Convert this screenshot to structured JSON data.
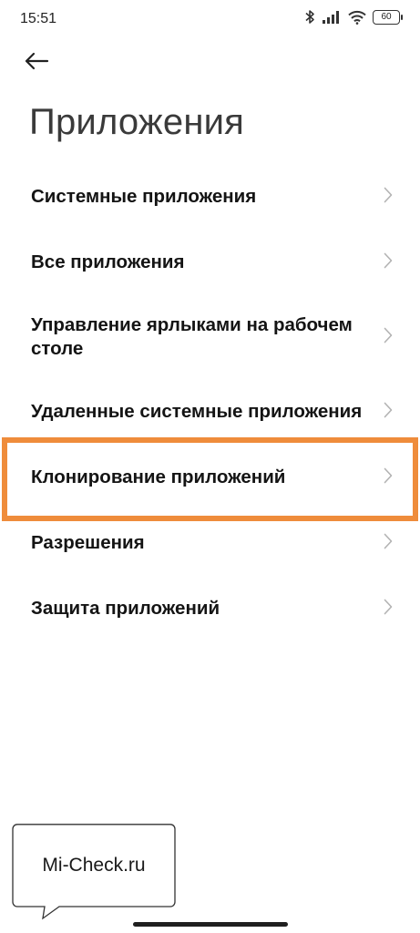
{
  "status_bar": {
    "time": "15:51",
    "battery_level": "60",
    "icons": [
      "bluetooth-icon",
      "signal-icon",
      "wifi-icon",
      "battery-icon"
    ]
  },
  "header": {
    "back_icon": "arrow-left-icon",
    "title": "Приложения"
  },
  "menu": {
    "items": [
      {
        "label": "Системные приложения"
      },
      {
        "label": "Все приложения"
      },
      {
        "label": "Управление ярлыками на рабочем столе"
      },
      {
        "label": "Удаленные системные приложения"
      },
      {
        "label": "Клонирование приложений",
        "highlighted": true
      },
      {
        "label": "Разрешения"
      },
      {
        "label": "Защита приложений"
      }
    ],
    "chevron_icon": "chevron-right-icon"
  },
  "highlight_color": "#ef8c3b",
  "watermark": {
    "text": "Mi-Check.ru"
  }
}
